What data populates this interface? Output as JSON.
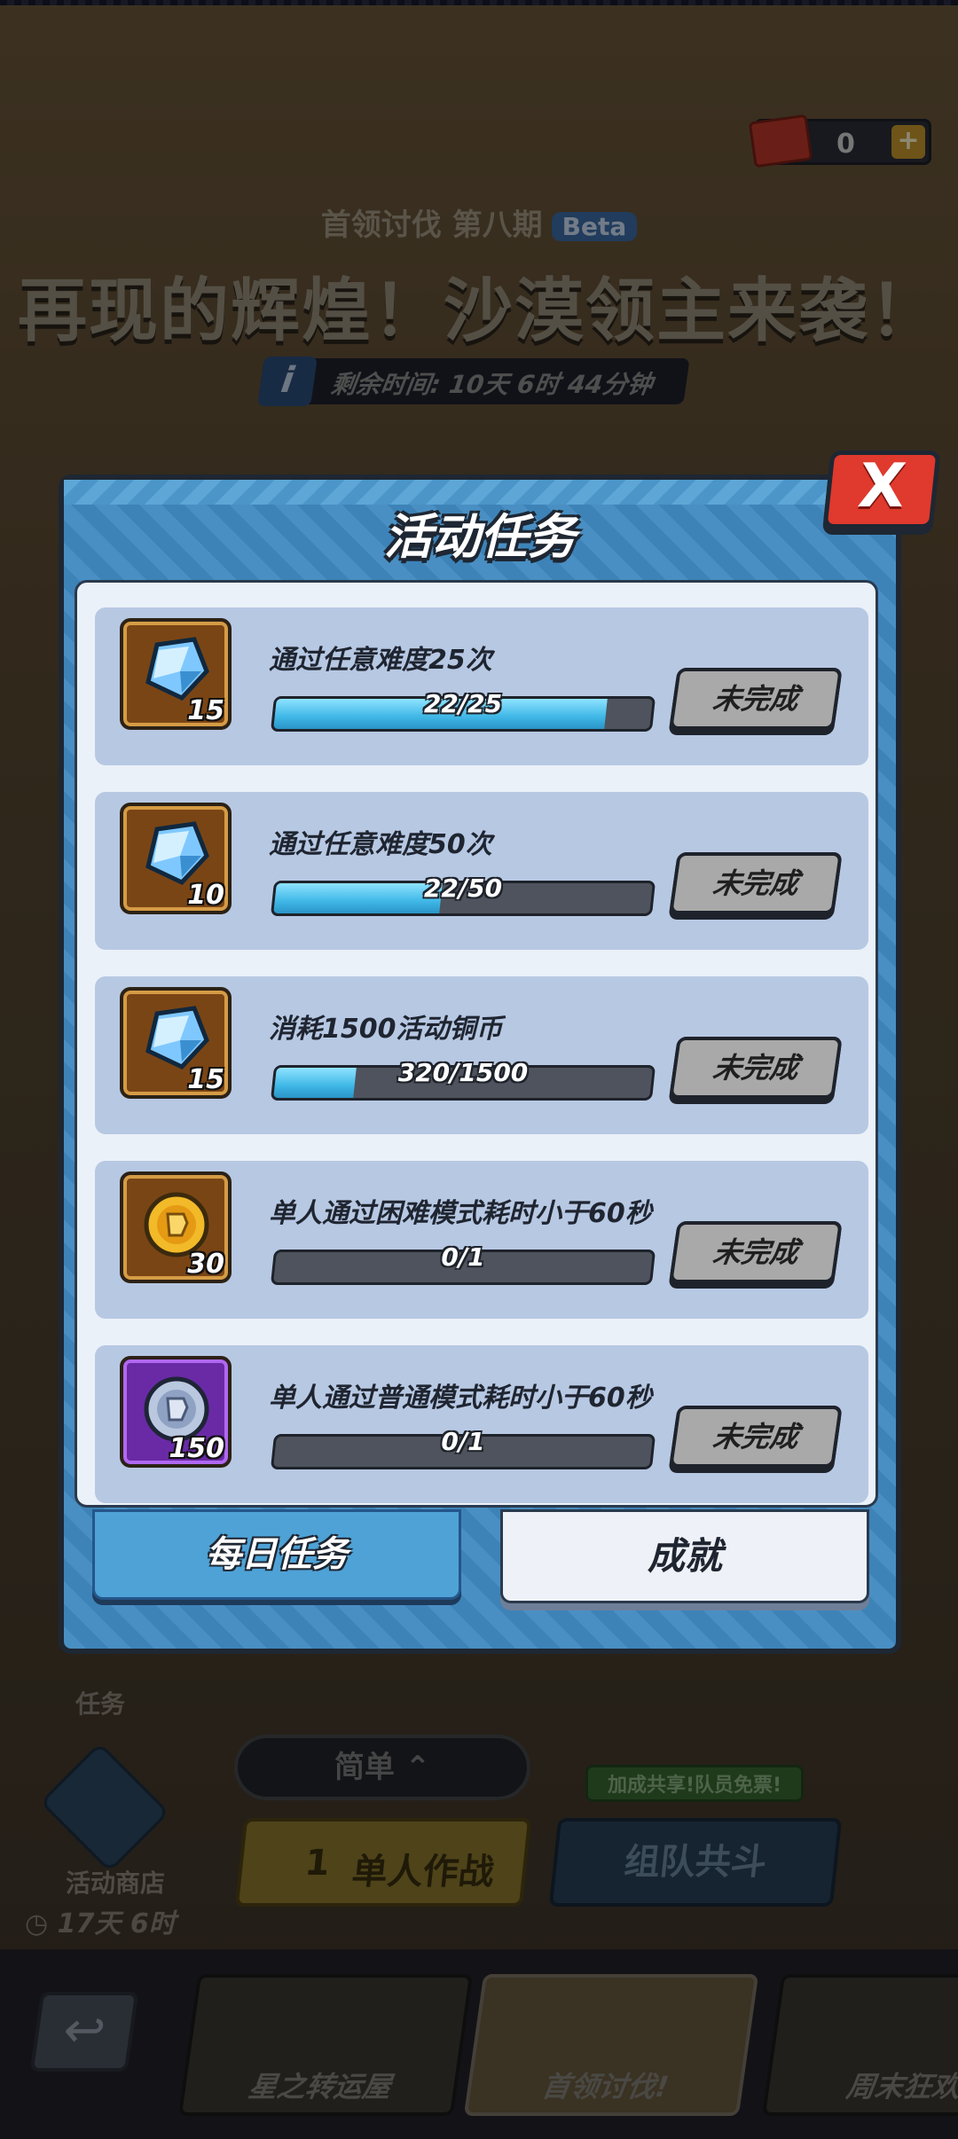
{
  "currency": {
    "value": "0",
    "plus": "+"
  },
  "event": {
    "subtitle": "首领讨伐 第八期",
    "beta": "Beta",
    "title": "再现的辉煌！沙漠领主来袭！",
    "info_icon": "i",
    "remaining": "剩余时间: 10天 6时 44分钟"
  },
  "modal": {
    "title": "活动任务",
    "close": "X",
    "tasks": [
      {
        "name": "通过任意难度25次",
        "progress": "22/25",
        "ratio": 0.88,
        "reward_icon": "blue-gem-icon",
        "reward_count": "15",
        "status": "未完成"
      },
      {
        "name": "通过任意难度50次",
        "progress": "22/50",
        "ratio": 0.44,
        "reward_icon": "blue-gem-icon",
        "reward_count": "10",
        "status": "未完成"
      },
      {
        "name": "消耗1500活动铜币",
        "progress": "320/1500",
        "ratio": 0.2133,
        "reward_icon": "blue-gem-icon",
        "reward_count": "15",
        "status": "未完成"
      },
      {
        "name": "单人通过困难模式耗时小于60秒",
        "progress": "0/1",
        "ratio": 0,
        "reward_icon": "gold-coin-icon",
        "reward_count": "30",
        "status": "未完成"
      },
      {
        "name": "单人通过普通模式耗时小于60秒",
        "progress": "0/1",
        "ratio": 0,
        "reward_icon": "silver-coin-icon",
        "reward_count": "150",
        "status": "未完成"
      }
    ],
    "tabs": {
      "daily": "每日任务",
      "achievement": "成就"
    }
  },
  "background_ui": {
    "task_label": "任务",
    "difficulty": "简单",
    "solo_count": "1",
    "solo": "单人作战",
    "team": "组队共斗",
    "share_tip": "加成共享!队员免票!",
    "shop": "活动商店",
    "shop_time": "17天 6时"
  },
  "navbar": {
    "tabs": [
      "星之转运屋",
      "首领讨伐!",
      "周末狂欢"
    ]
  }
}
